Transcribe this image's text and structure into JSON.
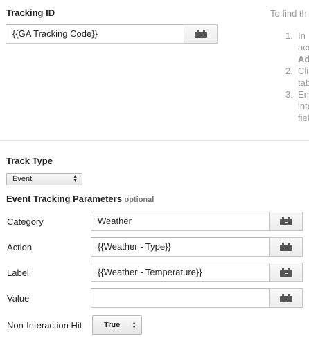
{
  "tracking": {
    "label": "Tracking ID",
    "value": "{{GA Tracking Code}}"
  },
  "help": {
    "intro": "To find th",
    "steps": [
      {
        "num": "1.",
        "lines": [
          "In",
          "acc",
          "Ad"
        ]
      },
      {
        "num": "2.",
        "lines": [
          "Cli",
          "tab"
        ]
      },
      {
        "num": "3.",
        "lines": [
          "En",
          "inte",
          "fiel"
        ]
      }
    ]
  },
  "track_type": {
    "label": "Track Type",
    "selected": "Event"
  },
  "event_params": {
    "title": "Event Tracking Parameters",
    "optional": "optional",
    "rows": [
      {
        "label": "Category",
        "value": "Weather"
      },
      {
        "label": "Action",
        "value": "{{Weather - Type}}"
      },
      {
        "label": "Label",
        "value": "{{Weather - Temperature}}"
      },
      {
        "label": "Value",
        "value": ""
      }
    ]
  },
  "non_interaction": {
    "label": "Non-Interaction Hit",
    "selected": "True"
  },
  "icons": {
    "macro": "lego-brick-icon",
    "select_arrows": "up-down-arrows-icon"
  }
}
